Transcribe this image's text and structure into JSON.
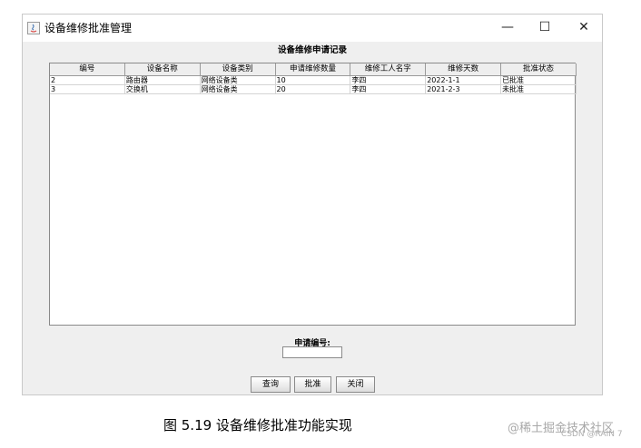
{
  "window": {
    "title": "设备维修批准管理",
    "controls": {
      "minimize": "—",
      "maximize": "☐",
      "close": "✕"
    }
  },
  "main": {
    "heading": "设备维修申请记录",
    "table": {
      "columns": [
        "编号",
        "设备名称",
        "设备类别",
        "申请维修数量",
        "维修工人名字",
        "维修天数",
        "批准状态"
      ],
      "rows": [
        [
          "2",
          "路由器",
          "网络设备类",
          "10",
          "李四",
          "2022-1-1",
          "已批准"
        ],
        [
          "3",
          "交换机",
          "网络设备类",
          "20",
          "李四",
          "2021-2-3",
          "未批准"
        ]
      ]
    },
    "form": {
      "label": "申请编号:",
      "value": "",
      "placeholder": ""
    },
    "buttons": {
      "query": "查询",
      "approve": "批准",
      "close": "关闭"
    }
  },
  "caption": "图 5.19 设备维修批准功能实现",
  "watermarks": [
    "@稀土掘金技术社区",
    "CSDN @RAIN 7"
  ]
}
